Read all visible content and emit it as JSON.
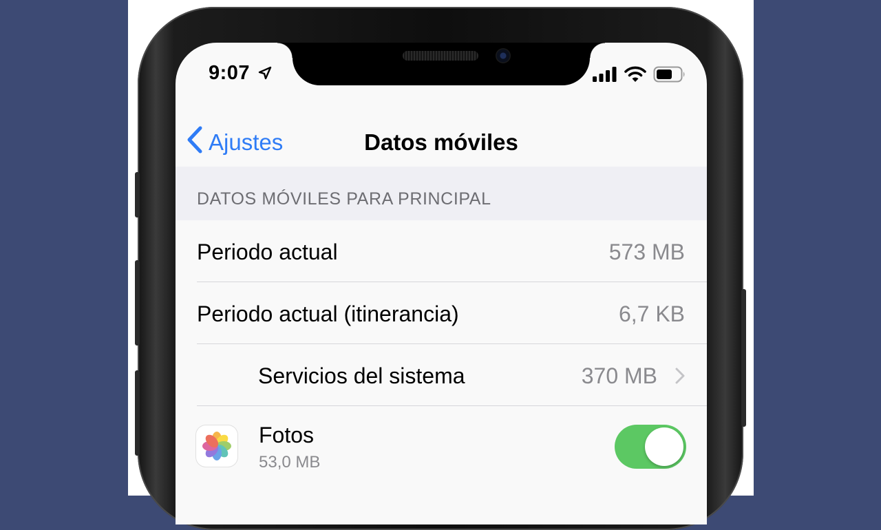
{
  "status_bar": {
    "time": "9:07",
    "location_icon": "location-arrow-icon",
    "signal_icon": "cellular-signal-icon",
    "wifi_icon": "wifi-icon",
    "battery_icon": "battery-icon"
  },
  "nav": {
    "back_label": "Ajustes",
    "title": "Datos móviles"
  },
  "section": {
    "header": "DATOS MÓVILES PARA PRINCIPAL"
  },
  "rows": [
    {
      "label": "Periodo actual",
      "value": "573 MB"
    },
    {
      "label": "Periodo actual (itinerancia)",
      "value": "6,7 KB"
    },
    {
      "label": "Servicios del sistema",
      "value": "370 MB"
    }
  ],
  "apps": [
    {
      "name": "Fotos",
      "usage": "53,0 MB",
      "icon": "photos-app-icon",
      "enabled": true
    }
  ],
  "colors": {
    "accent": "#2f7cf6",
    "toggle_on": "#5cc863",
    "background": "#3d4a74"
  }
}
